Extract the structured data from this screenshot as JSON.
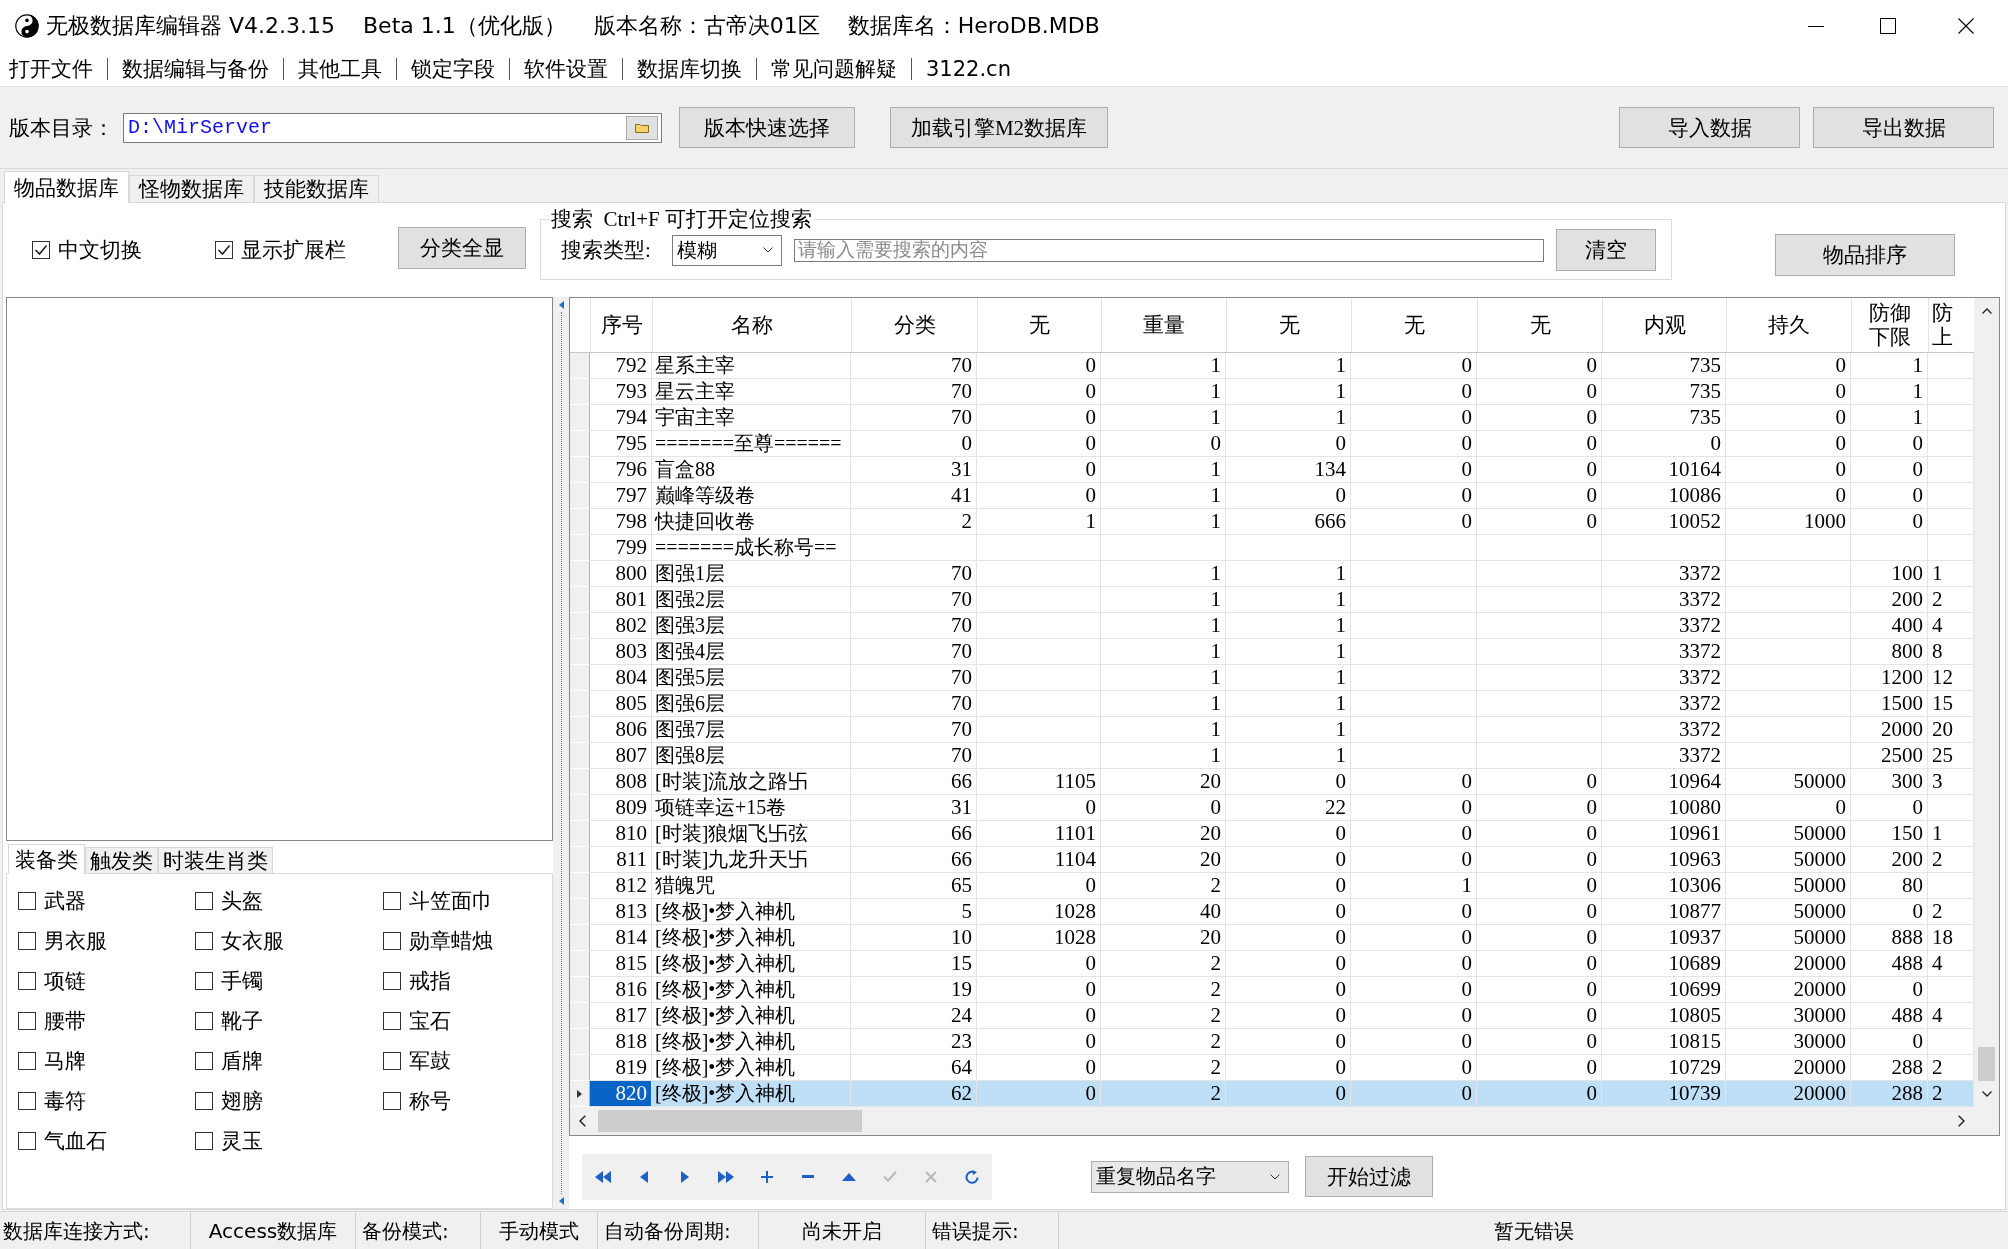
{
  "window": {
    "title_parts": [
      "无极数据库编辑器 V4.2.3.15",
      "Beta 1.1（优化版）",
      "版本名称：古帝决01区",
      "数据库名：HeroDB.MDB"
    ]
  },
  "menu": [
    "打开文件",
    "数据编辑与备份",
    "其他工具",
    "锁定字段",
    "软件设置",
    "数据库切换",
    "常见问题解疑",
    "3122.cn"
  ],
  "toolbar": {
    "path_label": "版本目录：",
    "path_value": "D:\\MirServer",
    "buttons": [
      "版本快速选择",
      "加载引擎M2数据库"
    ],
    "right_buttons": [
      "导入数据",
      "导出数据"
    ]
  },
  "tabs": [
    {
      "label": "物品数据库",
      "selected": true
    },
    {
      "label": "怪物数据库",
      "selected": false
    },
    {
      "label": "技能数据库",
      "selected": false
    }
  ],
  "options": {
    "checks": [
      {
        "label": "中文切换",
        "checked": true
      },
      {
        "label": "显示扩展栏",
        "checked": true
      }
    ],
    "show_all_button": "分类全显"
  },
  "search": {
    "legend": "搜索  Ctrl+F 可打开定位搜索",
    "type_label": "搜索类型:",
    "type_value": "模糊",
    "placeholder": "请输入需要搜索的内容",
    "clear_button": "清空"
  },
  "sort_button": "物品排序",
  "category_tabs": [
    {
      "label": "装备类",
      "selected": true
    },
    {
      "label": "触发类",
      "selected": false
    },
    {
      "label": "时装生肖类",
      "selected": false
    }
  ],
  "categories": [
    {
      "label": "武器",
      "checked": false
    },
    {
      "label": "头盔",
      "checked": false
    },
    {
      "label": "斗笠面巾",
      "checked": false
    },
    {
      "label": "男衣服",
      "checked": false
    },
    {
      "label": "女衣服",
      "checked": false
    },
    {
      "label": "勋章蜡烛",
      "checked": false
    },
    {
      "label": "项链",
      "checked": false
    },
    {
      "label": "手镯",
      "checked": false
    },
    {
      "label": "戒指",
      "checked": false
    },
    {
      "label": "腰带",
      "checked": false
    },
    {
      "label": "靴子",
      "checked": false
    },
    {
      "label": "宝石",
      "checked": false
    },
    {
      "label": "马牌",
      "checked": false
    },
    {
      "label": "盾牌",
      "checked": false
    },
    {
      "label": "军鼓",
      "checked": false
    },
    {
      "label": "毒符",
      "checked": false
    },
    {
      "label": "翅膀",
      "checked": false
    },
    {
      "label": "称号",
      "checked": false
    },
    {
      "label": "气血石",
      "checked": false
    },
    {
      "label": "灵玉",
      "checked": false
    }
  ],
  "table": {
    "columns": [
      "序号",
      "名称",
      "分类",
      "无",
      "重量",
      "无",
      "无",
      "无",
      "内观",
      "持久",
      "防御下限",
      "防上"
    ],
    "rows": [
      {
        "cells": [
          "792",
          "星系主宰",
          "70",
          "0",
          "1",
          "1",
          "0",
          "0",
          "735",
          "0",
          "1",
          null
        ],
        "selected": false
      },
      {
        "cells": [
          "793",
          "星云主宰",
          "70",
          "0",
          "1",
          "1",
          "0",
          "0",
          "735",
          "0",
          "1",
          null
        ],
        "selected": false
      },
      {
        "cells": [
          "794",
          "宇宙主宰",
          "70",
          "0",
          "1",
          "1",
          "0",
          "0",
          "735",
          "0",
          "1",
          null
        ],
        "selected": false
      },
      {
        "cells": [
          "795",
          "=======至尊======",
          "0",
          "0",
          "0",
          "0",
          "0",
          "0",
          "0",
          "0",
          "0",
          null
        ],
        "selected": false
      },
      {
        "cells": [
          "796",
          "盲盒88",
          "31",
          "0",
          "1",
          "134",
          "0",
          "0",
          "10164",
          "0",
          "0",
          null
        ],
        "selected": false
      },
      {
        "cells": [
          "797",
          "巅峰等级卷",
          "41",
          "0",
          "1",
          "0",
          "0",
          "0",
          "10086",
          "0",
          "0",
          null
        ],
        "selected": false
      },
      {
        "cells": [
          "798",
          "快捷回收卷",
          "2",
          "1",
          "1",
          "666",
          "0",
          "0",
          "10052",
          "1000",
          "0",
          null
        ],
        "selected": false
      },
      {
        "cells": [
          "799",
          "=======成长称号==",
          null,
          null,
          null,
          null,
          null,
          null,
          null,
          null,
          null,
          null
        ],
        "selected": false
      },
      {
        "cells": [
          "800",
          "图强1层",
          "70",
          null,
          "1",
          "1",
          null,
          null,
          "3372",
          null,
          "100",
          "1"
        ],
        "selected": false
      },
      {
        "cells": [
          "801",
          "图强2层",
          "70",
          null,
          "1",
          "1",
          null,
          null,
          "3372",
          null,
          "200",
          "2"
        ],
        "selected": false
      },
      {
        "cells": [
          "802",
          "图强3层",
          "70",
          null,
          "1",
          "1",
          null,
          null,
          "3372",
          null,
          "400",
          "4"
        ],
        "selected": false
      },
      {
        "cells": [
          "803",
          "图强4层",
          "70",
          null,
          "1",
          "1",
          null,
          null,
          "3372",
          null,
          "800",
          "8"
        ],
        "selected": false
      },
      {
        "cells": [
          "804",
          "图强5层",
          "70",
          null,
          "1",
          "1",
          null,
          null,
          "3372",
          null,
          "1200",
          "12"
        ],
        "selected": false
      },
      {
        "cells": [
          "805",
          "图强6层",
          "70",
          null,
          "1",
          "1",
          null,
          null,
          "3372",
          null,
          "1500",
          "15"
        ],
        "selected": false
      },
      {
        "cells": [
          "806",
          "图强7层",
          "70",
          null,
          "1",
          "1",
          null,
          null,
          "3372",
          null,
          "2000",
          "20"
        ],
        "selected": false
      },
      {
        "cells": [
          "807",
          "图强8层",
          "70",
          null,
          "1",
          "1",
          null,
          null,
          "3372",
          null,
          "2500",
          "25"
        ],
        "selected": false
      },
      {
        "cells": [
          "808",
          "[时装]流放之路卐",
          "66",
          "1105",
          "20",
          "0",
          "0",
          "0",
          "10964",
          "50000",
          "300",
          "3"
        ],
        "selected": false
      },
      {
        "cells": [
          "809",
          "项链幸运+15卷",
          "31",
          "0",
          "0",
          "22",
          "0",
          "0",
          "10080",
          "0",
          "0",
          null
        ],
        "selected": false
      },
      {
        "cells": [
          "810",
          "[时装]狼烟飞卐弦",
          "66",
          "1101",
          "20",
          "0",
          "0",
          "0",
          "10961",
          "50000",
          "150",
          "1"
        ],
        "selected": false
      },
      {
        "cells": [
          "811",
          "[时装]九龙升天卐",
          "66",
          "1104",
          "20",
          "0",
          "0",
          "0",
          "10963",
          "50000",
          "200",
          "2"
        ],
        "selected": false
      },
      {
        "cells": [
          "812",
          "猎魄咒",
          "65",
          "0",
          "2",
          "0",
          "1",
          "0",
          "10306",
          "50000",
          "80",
          null
        ],
        "selected": false
      },
      {
        "cells": [
          "813",
          "[终极]•梦入神机",
          "5",
          "1028",
          "40",
          "0",
          "0",
          "0",
          "10877",
          "50000",
          "0",
          "2"
        ],
        "selected": false
      },
      {
        "cells": [
          "814",
          "[终极]•梦入神机",
          "10",
          "1028",
          "20",
          "0",
          "0",
          "0",
          "10937",
          "50000",
          "888",
          "18"
        ],
        "selected": false
      },
      {
        "cells": [
          "815",
          "[终极]•梦入神机",
          "15",
          "0",
          "2",
          "0",
          "0",
          "0",
          "10689",
          "20000",
          "488",
          "4"
        ],
        "selected": false
      },
      {
        "cells": [
          "816",
          "[终极]•梦入神机",
          "19",
          "0",
          "2",
          "0",
          "0",
          "0",
          "10699",
          "20000",
          "0",
          null
        ],
        "selected": false
      },
      {
        "cells": [
          "817",
          "[终极]•梦入神机",
          "24",
          "0",
          "2",
          "0",
          "0",
          "0",
          "10805",
          "30000",
          "488",
          "4"
        ],
        "selected": false
      },
      {
        "cells": [
          "818",
          "[终极]•梦入神机",
          "23",
          "0",
          "2",
          "0",
          "0",
          "0",
          "10815",
          "30000",
          "0",
          null
        ],
        "selected": false
      },
      {
        "cells": [
          "819",
          "[终极]•梦入神机",
          "64",
          "0",
          "2",
          "0",
          "0",
          "0",
          "10729",
          "20000",
          "288",
          "2"
        ],
        "selected": false
      },
      {
        "cells": [
          "820",
          "[终极]•梦入神机",
          "62",
          "0",
          "2",
          "0",
          "0",
          "0",
          "10739",
          "20000",
          "288",
          "2"
        ],
        "selected": true
      }
    ]
  },
  "nav_buttons": [
    {
      "kind": "first",
      "disabled": false
    },
    {
      "kind": "prior",
      "disabled": false
    },
    {
      "kind": "next",
      "disabled": false
    },
    {
      "kind": "last",
      "disabled": false
    },
    {
      "kind": "insert",
      "disabled": false
    },
    {
      "kind": "delete",
      "disabled": false
    },
    {
      "kind": "edit",
      "disabled": false
    },
    {
      "kind": "post",
      "disabled": true
    },
    {
      "kind": "cancel",
      "disabled": true
    },
    {
      "kind": "refresh",
      "disabled": false
    }
  ],
  "filter": {
    "value": "重复物品名字",
    "button": "开始过滤"
  },
  "status_bar": [
    {
      "label": "数据库连接方式:",
      "value": "Access数据库"
    },
    {
      "label": "备份模式:",
      "value": "手动模式"
    },
    {
      "label": "自动备份周期:",
      "value": "尚未开启"
    },
    {
      "label": "错误提示:",
      "value": "暂无错误"
    }
  ]
}
